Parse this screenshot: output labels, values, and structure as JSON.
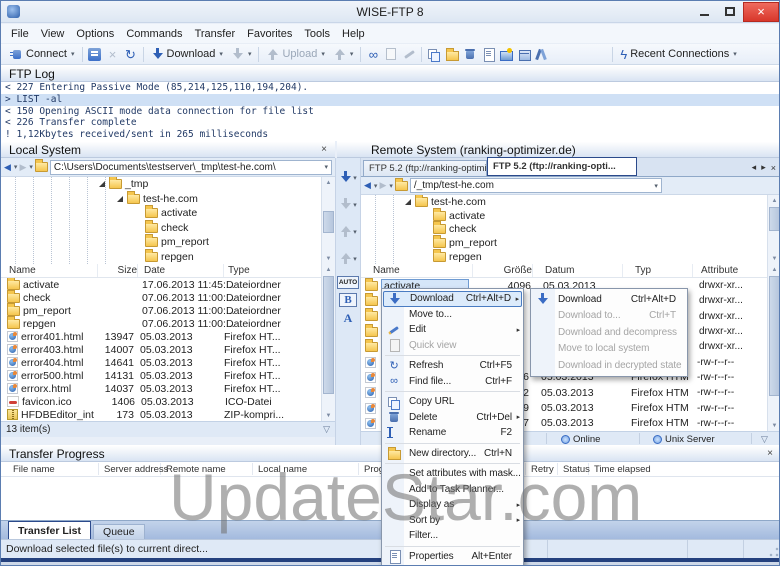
{
  "window": {
    "title": "WISE-FTP 8"
  },
  "colors": {
    "accent_blue": "#2e5fb5",
    "close_red": "#d8372b",
    "selection_blue": "#d5e6f9",
    "watermark_gray": "#6f6f6f"
  },
  "icon_glyphs": {
    "dropdown-icon": "▾",
    "close-icon": "×",
    "refresh-icon": "↻",
    "lightning-icon": "ϟ",
    "find-icon": "∞",
    "back-icon": "◀",
    "forward-icon": "▶",
    "submenu-arrow-icon": "▸",
    "funnel-icon": "▽",
    "scroll-up-icon": "▲",
    "scroll-down-icon": "▼",
    "tab-left-icon": "◂",
    "tab-right-icon": "▸",
    "disconnect-icon": "×"
  },
  "menu_bar": [
    "File",
    "View",
    "Options",
    "Commands",
    "Transfer",
    "Favorites",
    "Tools",
    "Help"
  ],
  "toolbar": {
    "connect": "Connect",
    "download": "Download",
    "upload": "Upload",
    "recent_connections": "Recent Connections"
  },
  "ftp_log": {
    "title": "FTP Log",
    "lines": [
      {
        "text": "< 227 Entering Passive Mode (85,214,125,110,194,204).",
        "highlight": false
      },
      {
        "text": "> LIST -al",
        "highlight": true
      },
      {
        "text": "< 150 Opening ASCII mode data connection for file list",
        "highlight": false
      },
      {
        "text": "< 226 Transfer complete",
        "highlight": false
      },
      {
        "text": "! 1,12Kbytes received/sent in 265 milliseconds",
        "highlight": false
      }
    ]
  },
  "local": {
    "title": "Local System",
    "path": "C:\\Users\\Documents\\testserver\\_tmp\\test-he.com\\",
    "tree": [
      {
        "label": "_tmp",
        "indent": 5,
        "expanded": true
      },
      {
        "label": "test-he.com",
        "indent": 6,
        "expanded": true
      },
      {
        "label": "activate",
        "indent": 7,
        "expanded": false
      },
      {
        "label": "check",
        "indent": 7,
        "expanded": false
      },
      {
        "label": "pm_report",
        "indent": 7,
        "expanded": false
      },
      {
        "label": "repgen",
        "indent": 7,
        "expanded": false
      }
    ],
    "columns": [
      "Name",
      "Size",
      "Date",
      "Type"
    ],
    "rows": [
      {
        "icon": "folder",
        "name": "activate",
        "size": "",
        "date": "17.06.2013 11:45:...",
        "type": "Dateiordner"
      },
      {
        "icon": "folder",
        "name": "check",
        "size": "",
        "date": "07.06.2013 11:00:...",
        "type": "Dateiordner"
      },
      {
        "icon": "folder",
        "name": "pm_report",
        "size": "",
        "date": "07.06.2013 11:00:...",
        "type": "Dateiordner"
      },
      {
        "icon": "folder",
        "name": "repgen",
        "size": "",
        "date": "07.06.2013 11:00:...",
        "type": "Dateiordner"
      },
      {
        "icon": "firefox",
        "name": "error401.html",
        "size": "13947",
        "date": "05.03.2013",
        "type": "Firefox HT..."
      },
      {
        "icon": "firefox",
        "name": "error403.html",
        "size": "14007",
        "date": "05.03.2013",
        "type": "Firefox HT..."
      },
      {
        "icon": "firefox",
        "name": "error404.html",
        "size": "14641",
        "date": "05.03.2013",
        "type": "Firefox HT..."
      },
      {
        "icon": "firefox",
        "name": "error500.html",
        "size": "14131",
        "date": "05.03.2013",
        "type": "Firefox HT..."
      },
      {
        "icon": "firefox",
        "name": "errorx.html",
        "size": "14037",
        "date": "05.03.2013",
        "type": "Firefox HT..."
      },
      {
        "icon": "ico",
        "name": "favicon.ico",
        "size": "1406",
        "date": "05.03.2013",
        "type": "ICO-Datei"
      },
      {
        "icon": "zip",
        "name": "HFDBEditor_inte",
        "size": "173",
        "date": "05.03.2013",
        "type": "ZIP-kompri..."
      }
    ],
    "status": "13 item(s)"
  },
  "middle_toolbar": {
    "auto": "AUTO",
    "binary": "B",
    "ascii": "A"
  },
  "remote": {
    "title": "Remote System (ranking-optimizer.de)",
    "tabs": [
      {
        "label": "FTP 5.2 (ftp://ranking-optimi...",
        "active": false
      },
      {
        "label": "FTP 5.2 (ftp://ranking-opti...",
        "active": true
      }
    ],
    "path": "/_tmp/test-he.com",
    "tree": [
      {
        "label": "test-he.com",
        "indent": 2,
        "expanded": true
      },
      {
        "label": "activate",
        "indent": 3,
        "expanded": false
      },
      {
        "label": "check",
        "indent": 3,
        "expanded": false
      },
      {
        "label": "pm_report",
        "indent": 3,
        "expanded": false
      },
      {
        "label": "repgen",
        "indent": 3,
        "expanded": false
      }
    ],
    "columns": [
      "Name",
      "Größe",
      "Datum",
      "Typ",
      "Attribute"
    ],
    "rows": [
      {
        "icon": "folder",
        "name": "activate",
        "size": "4096",
        "date": "05.03.2013",
        "type": "",
        "attr": "drwxr-xr...",
        "selected": true
      },
      {
        "icon": "folder",
        "name": "",
        "size": "",
        "date": "",
        "type": "",
        "attr": "drwxr-xr...",
        "selected": false
      },
      {
        "icon": "folder",
        "name": "",
        "size": "",
        "date": "",
        "type": "",
        "attr": "drwxr-xr...",
        "selected": false
      },
      {
        "icon": "folder",
        "name": "",
        "size": "",
        "date": "",
        "type": "",
        "attr": "drwxr-xr...",
        "selected": false
      },
      {
        "icon": "folder",
        "name": "",
        "size": "",
        "date": "",
        "type": "",
        "attr": "drwxr-xr...",
        "selected": false
      },
      {
        "icon": "firefox",
        "name": "",
        "size": "",
        "date": "",
        "type": "",
        "attr": "-rw-r--r--",
        "selected": false
      },
      {
        "icon": "firefox",
        "name": "",
        "size": "796",
        "date": "05.03.2013",
        "type": "Firefox HTM...",
        "attr": "-rw-r--r--",
        "selected": false
      },
      {
        "icon": "firefox",
        "name": "",
        "size": "422",
        "date": "05.03.2013",
        "type": "Firefox HTM...",
        "attr": "-rw-r--r--",
        "selected": false
      },
      {
        "icon": "firefox",
        "name": "",
        "size": "919",
        "date": "05.03.2013",
        "type": "Firefox HTM...",
        "attr": "-rw-r--r--",
        "selected": false
      },
      {
        "icon": "firefox",
        "name": "",
        "size": "327",
        "date": "05.03.2013",
        "type": "Firefox HTM...",
        "attr": "-rw-r--r--",
        "selected": false
      }
    ],
    "status_online": "Online",
    "status_server": "Unix Server"
  },
  "context_menu": {
    "items": [
      {
        "icon": "download-icon",
        "label": "Download",
        "shortcut": "Ctrl+Alt+D",
        "submenu": true,
        "highlighted": true
      },
      {
        "icon": "",
        "label": "Move to...",
        "shortcut": ""
      },
      {
        "icon": "edit-icon",
        "label": "Edit",
        "shortcut": "",
        "submenu": true
      },
      {
        "icon": "quick-view-icon",
        "label": "Quick view",
        "shortcut": "",
        "disabled": true
      },
      {
        "separator": true
      },
      {
        "icon": "refresh-icon",
        "label": "Refresh",
        "shortcut": "Ctrl+F5"
      },
      {
        "icon": "find-icon",
        "label": "Find file...",
        "shortcut": "Ctrl+F"
      },
      {
        "separator": true
      },
      {
        "icon": "copy-url-icon",
        "label": "Copy URL",
        "shortcut": ""
      },
      {
        "icon": "delete-icon",
        "label": "Delete",
        "shortcut": "Ctrl+Del",
        "submenu": true
      },
      {
        "icon": "rename-icon",
        "label": "Rename",
        "shortcut": "F2"
      },
      {
        "separator": true
      },
      {
        "icon": "new-directory-icon",
        "label": "New directory...",
        "shortcut": "Ctrl+N"
      },
      {
        "separator": true
      },
      {
        "icon": "",
        "label": "Set attributes with mask...",
        "shortcut": ""
      },
      {
        "icon": "",
        "label": "Add to Task Planner...",
        "shortcut": ""
      },
      {
        "icon": "",
        "label": "Display as",
        "shortcut": "",
        "submenu": true
      },
      {
        "icon": "",
        "label": "Sort by",
        "shortcut": "",
        "submenu": true
      },
      {
        "icon": "",
        "label": "Filter...",
        "shortcut": ""
      },
      {
        "separator": true
      },
      {
        "icon": "properties-icon",
        "label": "Properties",
        "shortcut": "Alt+Enter"
      }
    ]
  },
  "context_submenu": {
    "items": [
      {
        "icon": "download-icon",
        "label": "Download",
        "shortcut": "Ctrl+Alt+D"
      },
      {
        "icon": "",
        "label": "Download to...",
        "shortcut": "Ctrl+T",
        "disabled": true
      },
      {
        "icon": "",
        "label": "Download and decompress",
        "shortcut": "",
        "disabled": true
      },
      {
        "icon": "",
        "label": "Move to local system",
        "shortcut": "",
        "disabled": true
      },
      {
        "icon": "",
        "label": "Download in decrypted state",
        "shortcut": "",
        "disabled": true
      }
    ]
  },
  "transfer": {
    "title": "Transfer Progress",
    "columns": [
      "File name",
      "Server address",
      "Remote name",
      "Local name",
      "Prog",
      "Retry",
      "Status",
      "Time elapsed"
    ],
    "tabs": [
      {
        "label": "Transfer List",
        "active": true
      },
      {
        "label": "Queue",
        "active": false
      }
    ]
  },
  "status_bar": {
    "text": "Download selected file(s) to current direct..."
  },
  "watermark": "UpdateStar.com"
}
